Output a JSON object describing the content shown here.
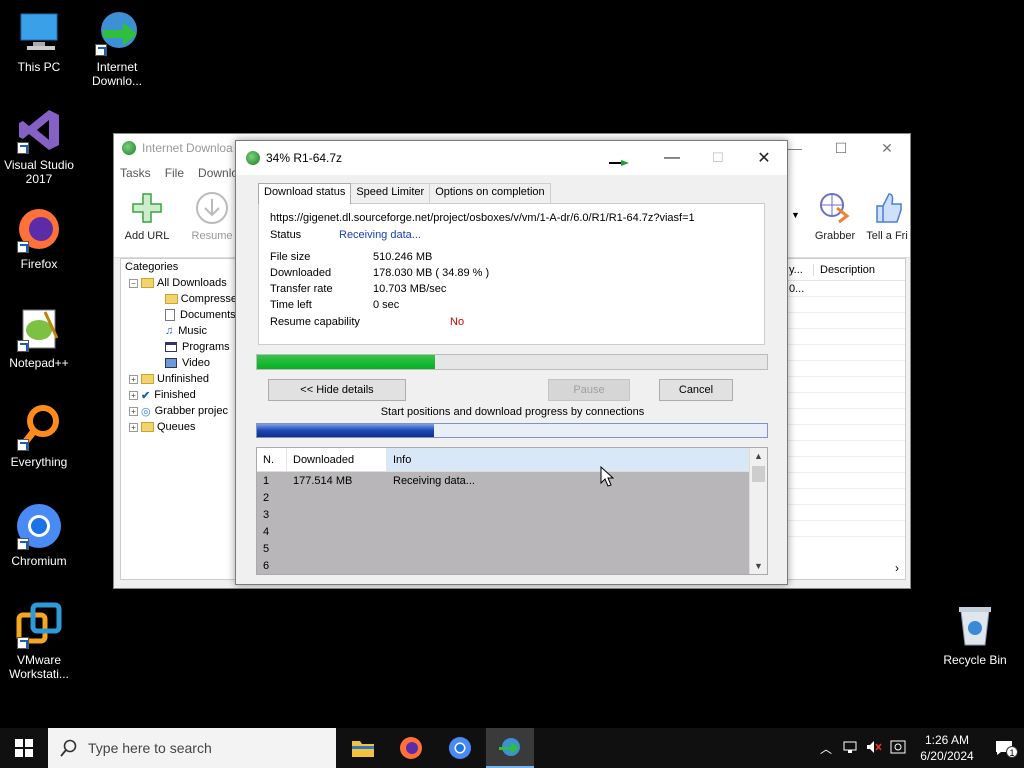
{
  "desktop": {
    "icons": [
      {
        "label": "This PC"
      },
      {
        "label": "Internet Downlo..."
      },
      {
        "label": "Visual Studio 2017"
      },
      {
        "label": "Firefox"
      },
      {
        "label": "Notepad++"
      },
      {
        "label": "Everything"
      },
      {
        "label": "Chromium"
      },
      {
        "label": "VMware Workstati..."
      },
      {
        "label": "Recycle Bin"
      }
    ]
  },
  "main_window": {
    "title": "Internet Downloa",
    "menu": [
      "Tasks",
      "File",
      "Downlo"
    ],
    "toolbar": {
      "add_url": "Add URL",
      "resume": "Resume",
      "grabber": "Grabber",
      "tell_friend": "Tell a Fri"
    },
    "categories_title": "Categories",
    "categories": [
      "All Downloads",
      "Compresse",
      "Documents",
      "Music",
      "Programs",
      "Video",
      "Unfinished",
      "Finished",
      "Grabber projec",
      "Queues"
    ],
    "list_headers": {
      "col1": "y...",
      "description": "Description"
    },
    "list_row1": "0..."
  },
  "dialog": {
    "title": "34% R1-64.7z",
    "tabs": [
      "Download status",
      "Speed Limiter",
      "Options on completion"
    ],
    "url": "https://gigenet.dl.sourceforge.net/project/osboxes/v/vm/1-A-dr/6.0/R1/R1-64.7z?viasf=1",
    "status_label": "Status",
    "status_value": "Receiving data...",
    "fields": [
      {
        "label": "File size",
        "value": "510.246  MB"
      },
      {
        "label": "Downloaded",
        "value": "178.030  MB  ( 34.89 % )"
      },
      {
        "label": "Transfer rate",
        "value": "10.703  MB/sec"
      },
      {
        "label": "Time left",
        "value": "0 sec"
      }
    ],
    "resume_label": "Resume capability",
    "resume_value": "No",
    "progress_fraction": 0.3489,
    "buttons": {
      "hide_details": "<< Hide details",
      "pause": "Pause",
      "cancel": "Cancel"
    },
    "connections_label": "Start positions and download progress by connections",
    "connections_progress_fraction": 0.348,
    "table_headers": {
      "n": "N.",
      "downloaded": "Downloaded",
      "info": "Info"
    },
    "rows": [
      {
        "n": "1",
        "downloaded": "177.514  MB",
        "info": "Receiving data..."
      },
      {
        "n": "2",
        "downloaded": "",
        "info": ""
      },
      {
        "n": "3",
        "downloaded": "",
        "info": ""
      },
      {
        "n": "4",
        "downloaded": "",
        "info": ""
      },
      {
        "n": "5",
        "downloaded": "",
        "info": ""
      },
      {
        "n": "6",
        "downloaded": "",
        "info": ""
      }
    ]
  },
  "taskbar": {
    "search_placeholder": "Type here to search",
    "time": "1:26 AM",
    "date": "6/20/2024",
    "notification_count": "1"
  },
  "colors": {
    "progress_green": "#06b025",
    "progress_blue": "#1d46b8",
    "resume_no": "#d40000",
    "status_link": "#1a3fb0"
  }
}
